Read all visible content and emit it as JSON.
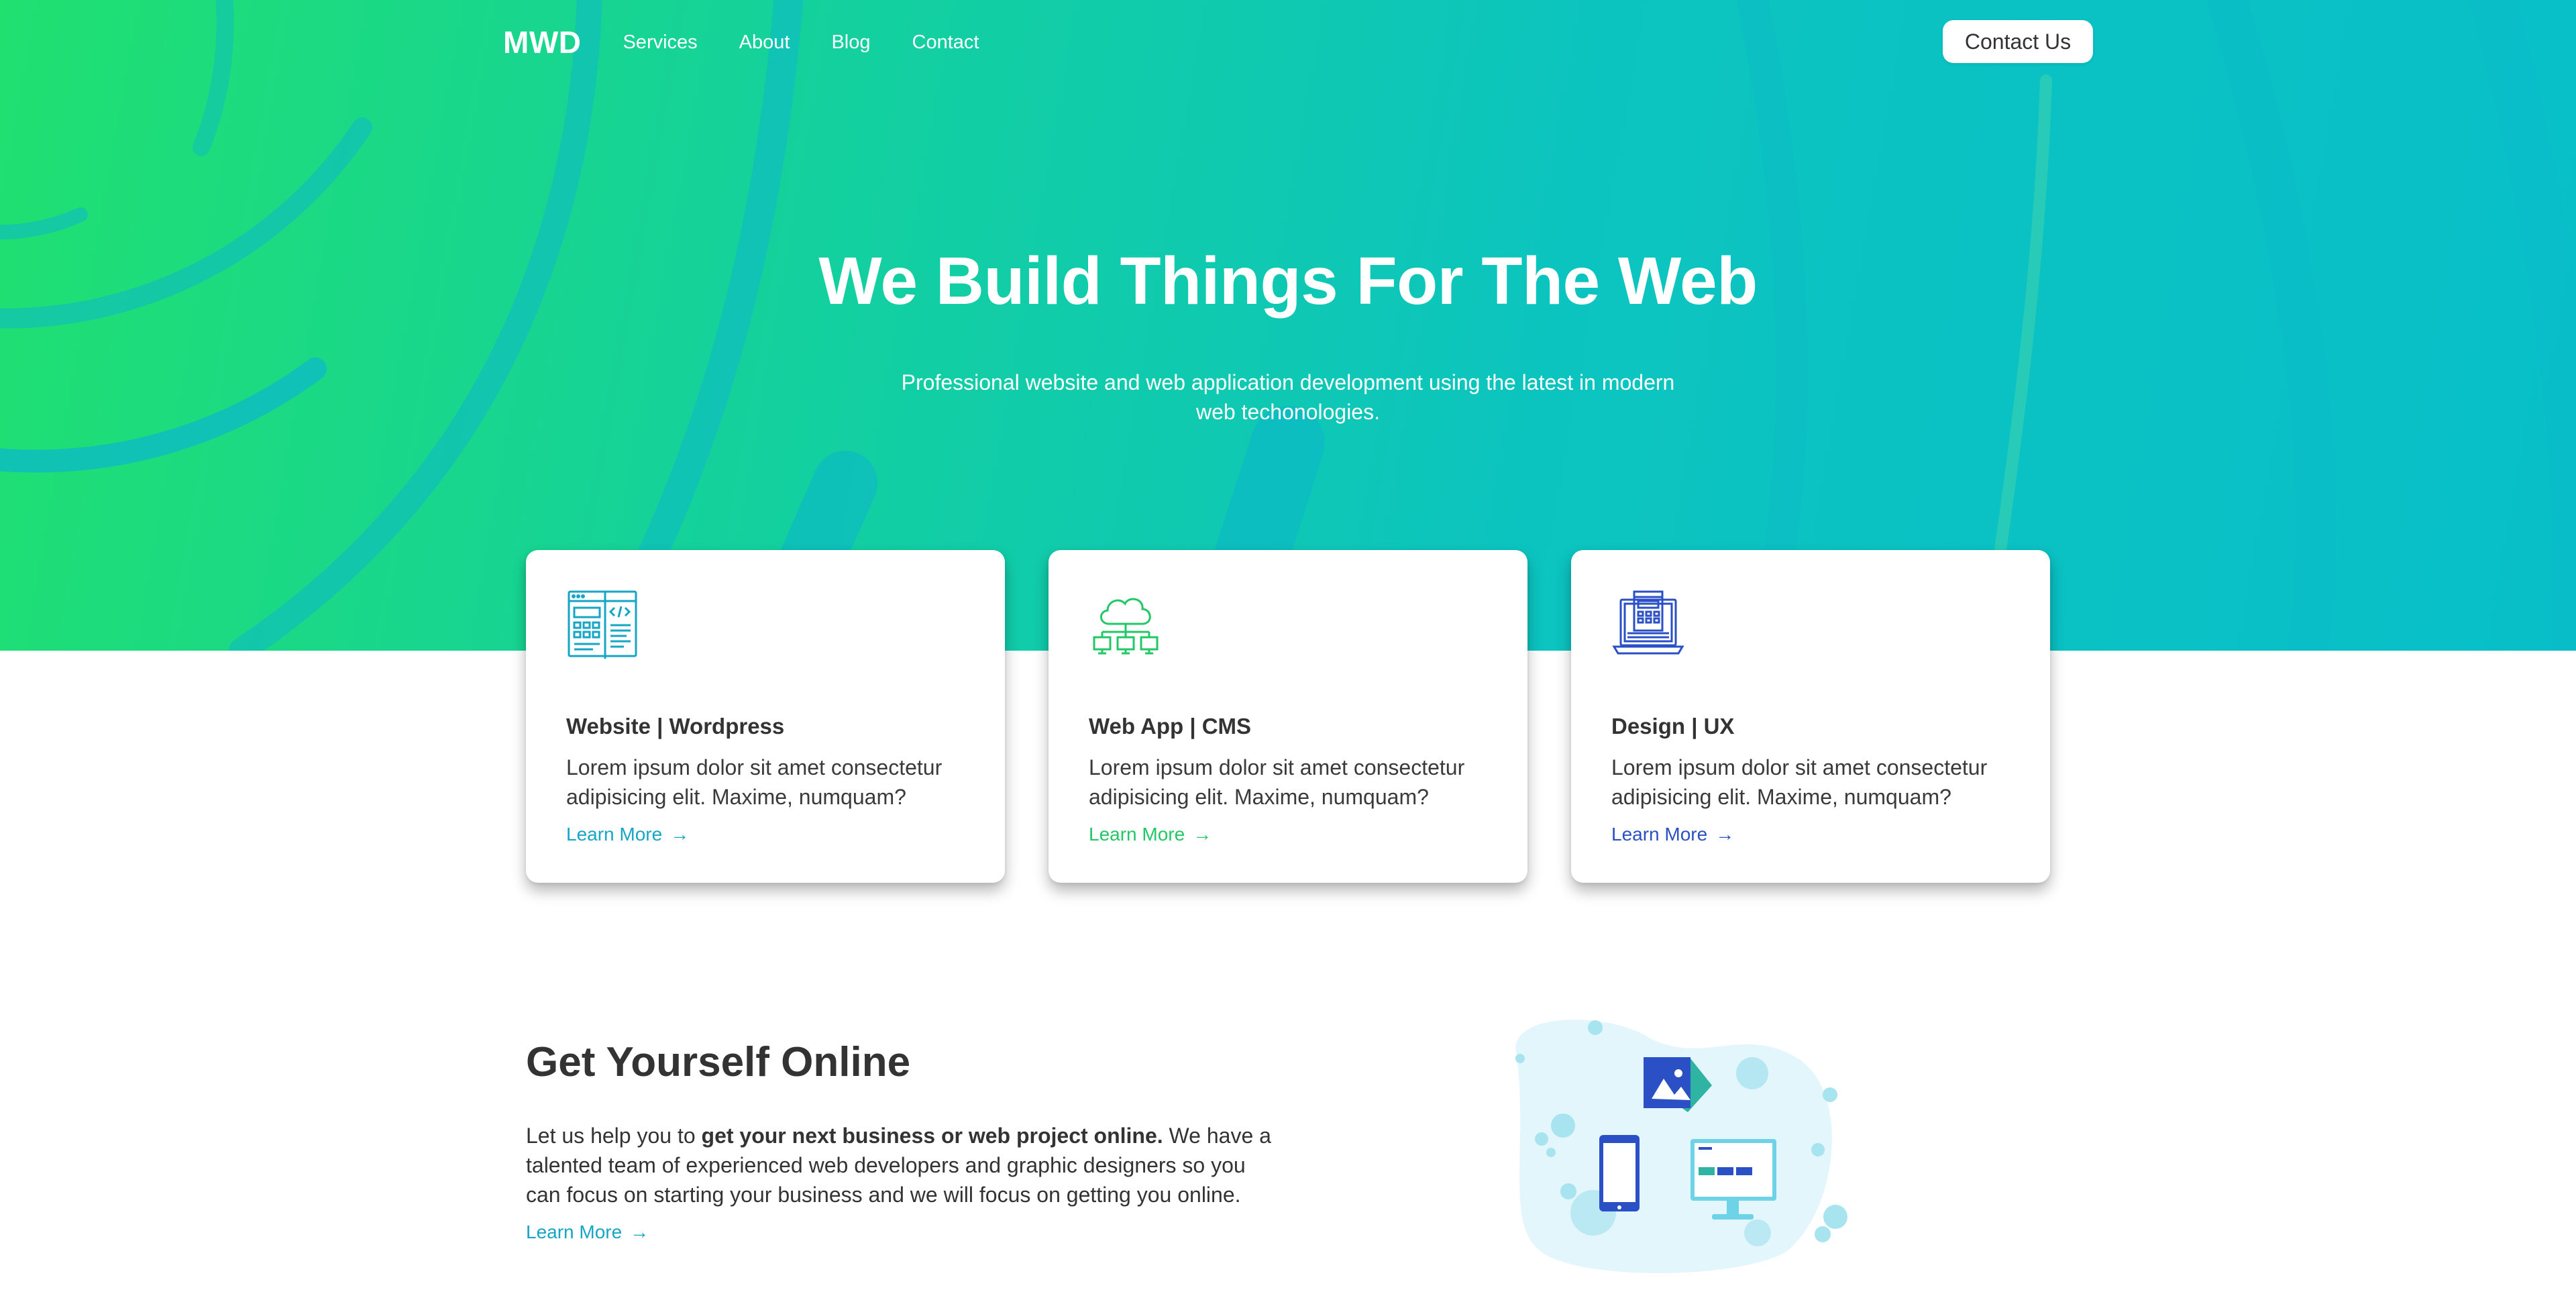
{
  "nav": {
    "logo": "MWD",
    "links": [
      "Services",
      "About",
      "Blog",
      "Contact"
    ],
    "cta_label": "Contact Us"
  },
  "hero": {
    "title": "We Build Things For The Web",
    "subtitle": "Professional website and web application development using the latest in modern web techonologies."
  },
  "cards": [
    {
      "icon": "website-code-icon",
      "title": "Website | Wordpress",
      "text": "Lorem ipsum dolor sit amet consectetur adipisicing elit. Maxime, numquam?",
      "link": "Learn More",
      "accent": "#16a5c6"
    },
    {
      "icon": "cloud-network-icon",
      "title": "Web App | CMS",
      "text": "Lorem ipsum dolor sit amet consectetur adipisicing elit. Maxime, numquam?",
      "link": "Learn More",
      "accent": "#22c766"
    },
    {
      "icon": "laptop-design-icon",
      "title": "Design | UX",
      "text": "Lorem ipsum dolor sit amet consectetur adipisicing elit. Maxime, numquam?",
      "link": "Learn More",
      "accent": "#2b4fc4"
    }
  ],
  "online": {
    "title": "Get Yourself Online",
    "text_before": "Let us help you to ",
    "text_bold": "get your next business or web project online.",
    "text_after": " We have a talented team of experienced web developers and graphic designers so you can focus on starting your business and we will focus on getting you online.",
    "link": "Learn More"
  },
  "colors": {
    "hero_gradient_start": "#20e070",
    "hero_gradient_end": "#08bfc9",
    "link_teal": "#16a5c6",
    "link_green": "#22c766",
    "link_blue": "#2b4fc4"
  }
}
